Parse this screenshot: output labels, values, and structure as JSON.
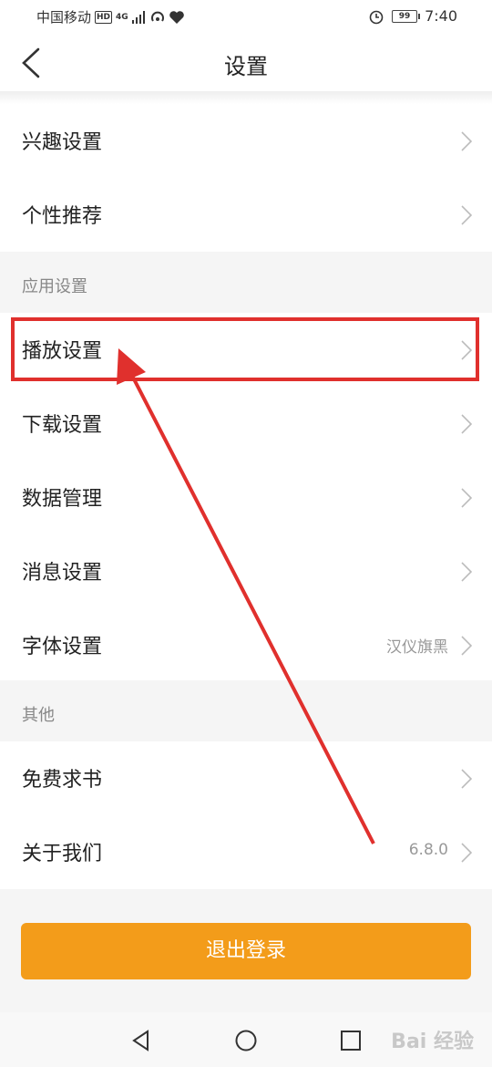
{
  "status_bar": {
    "carrier": "中国移动",
    "hd": "HD",
    "net": "4G",
    "battery": "99",
    "time": "7:40"
  },
  "header": {
    "title": "设置"
  },
  "rows_top": [
    {
      "label": "兴趣设置"
    },
    {
      "label": "个性推荐"
    }
  ],
  "section_app": {
    "label": "应用设置"
  },
  "rows_app": [
    {
      "label": "播放设置"
    },
    {
      "label": "下载设置"
    },
    {
      "label": "数据管理"
    },
    {
      "label": "消息设置"
    },
    {
      "label": "字体设置",
      "value": "汉仪旗黑"
    }
  ],
  "section_other": {
    "label": "其他"
  },
  "rows_other": [
    {
      "label": "免费求书"
    },
    {
      "label": "关于我们",
      "value": "6.8.0"
    }
  ],
  "logout": {
    "label": "退出登录"
  },
  "watermark": {
    "text": "Bai 经验"
  },
  "colors": {
    "accent": "#f39c1a",
    "annotation": "#e0302d"
  }
}
